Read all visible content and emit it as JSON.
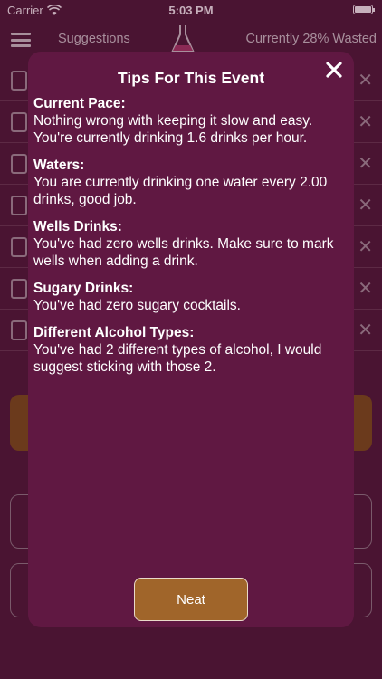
{
  "status_bar": {
    "carrier": "Carrier",
    "time": "5:03 PM"
  },
  "nav": {
    "suggestions_label": "Suggestions",
    "wasted_label": "Currently 28% Wasted"
  },
  "colors": {
    "modal_bg": "#601842",
    "app_bg": "#4a1432",
    "button_bg": "#a0652a"
  },
  "modal": {
    "title": "Tips For This Event",
    "tips": [
      {
        "heading": "Current Pace:",
        "body": "Nothing wrong with keeping it slow and easy. You're currently drinking 1.6 drinks per hour."
      },
      {
        "heading": "Waters:",
        "body": "You are currently drinking one water every 2.00 drinks, good job."
      },
      {
        "heading": "Wells Drinks:",
        "body": "You've had zero wells drinks. Make sure to mark wells when adding a drink."
      },
      {
        "heading": "Sugary Drinks:",
        "body": "You've had zero sugary cocktails."
      },
      {
        "heading": "Different Alcohol Types:",
        "body": "You've had 2 different types of alcohol, I would suggest sticking with those 2."
      }
    ],
    "confirm_label": "Neat"
  }
}
